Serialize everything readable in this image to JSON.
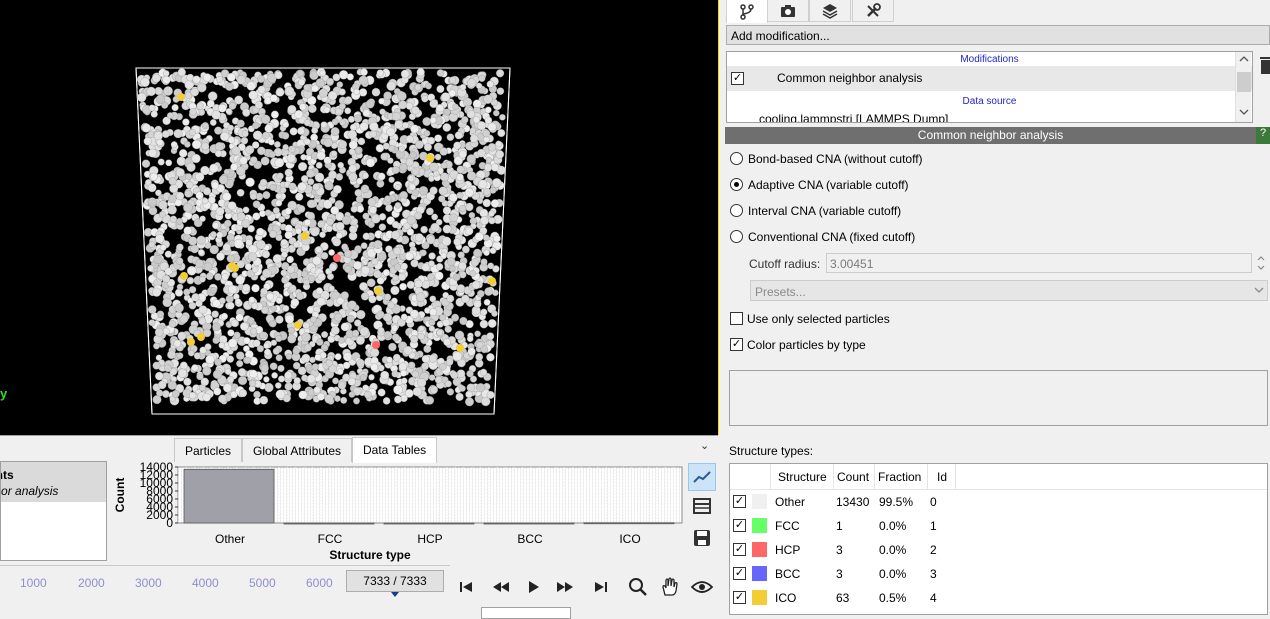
{
  "viewport": {
    "axis_label": "y"
  },
  "bottom_tabs": [
    {
      "label": "Particles"
    },
    {
      "label": "Global Attributes"
    },
    {
      "label": "Data Tables"
    }
  ],
  "table_list": {
    "line1": "ounts",
    "line2": "ghbor analysis"
  },
  "chart_data": {
    "type": "bar",
    "title": "",
    "xlabel": "Structure type",
    "ylabel": "Count",
    "categories": [
      "Other",
      "FCC",
      "HCP",
      "BCC",
      "ICO"
    ],
    "values": [
      13430,
      1,
      3,
      3,
      63
    ],
    "ylim": [
      0,
      14000
    ],
    "yticks": [
      0,
      2000,
      4000,
      6000,
      8000,
      10000,
      12000,
      14000
    ],
    "grid": true,
    "bar_color": "#a0a0a8"
  },
  "timeline": {
    "ticks": [
      "1000",
      "2000",
      "3000",
      "4000",
      "5000",
      "6000"
    ],
    "frame_display": "7333 / 7333"
  },
  "right_tabs": [
    {
      "icon": "pipeline-icon"
    },
    {
      "icon": "camera-icon"
    },
    {
      "icon": "layers-icon"
    },
    {
      "icon": "tools-icon"
    }
  ],
  "add_modification": "Add modification...",
  "pipeline": {
    "modifications_header": "Modifications",
    "modifier_name": "Common neighbor analysis",
    "data_source_header": "Data source",
    "source_name": "cooling.lammpstrj [LAMMPS Dump]"
  },
  "modifier_title": "Common neighbor analysis",
  "help_label": "?",
  "cna_modes": [
    {
      "label": "Bond-based CNA (without cutoff)",
      "selected": false
    },
    {
      "label": "Adaptive CNA (variable cutoff)",
      "selected": true
    },
    {
      "label": "Interval CNA (variable cutoff)",
      "selected": false
    },
    {
      "label": "Conventional CNA (fixed cutoff)",
      "selected": false
    }
  ],
  "cutoff": {
    "label": "Cutoff radius:",
    "value": "3.00451"
  },
  "presets_placeholder": "Presets...",
  "options": {
    "use_selected": "Use only selected particles",
    "color_by_type": "Color particles by type"
  },
  "structure_types_label": "Structure types:",
  "structure_table": {
    "headers": [
      "Structure",
      "Count",
      "Fraction",
      "Id"
    ],
    "rows": [
      {
        "name": "Other",
        "count": "13430",
        "fraction": "99.5%",
        "id": "0",
        "color": "#f0f0f0"
      },
      {
        "name": "FCC",
        "count": "1",
        "fraction": "0.0%",
        "id": "1",
        "color": "#66ff66"
      },
      {
        "name": "HCP",
        "count": "3",
        "fraction": "0.0%",
        "id": "2",
        "color": "#ff6666"
      },
      {
        "name": "BCC",
        "count": "3",
        "fraction": "0.0%",
        "id": "3",
        "color": "#6666ff"
      },
      {
        "name": "ICO",
        "count": "63",
        "fraction": "0.5%",
        "id": "4",
        "color": "#f2cd33"
      }
    ]
  }
}
